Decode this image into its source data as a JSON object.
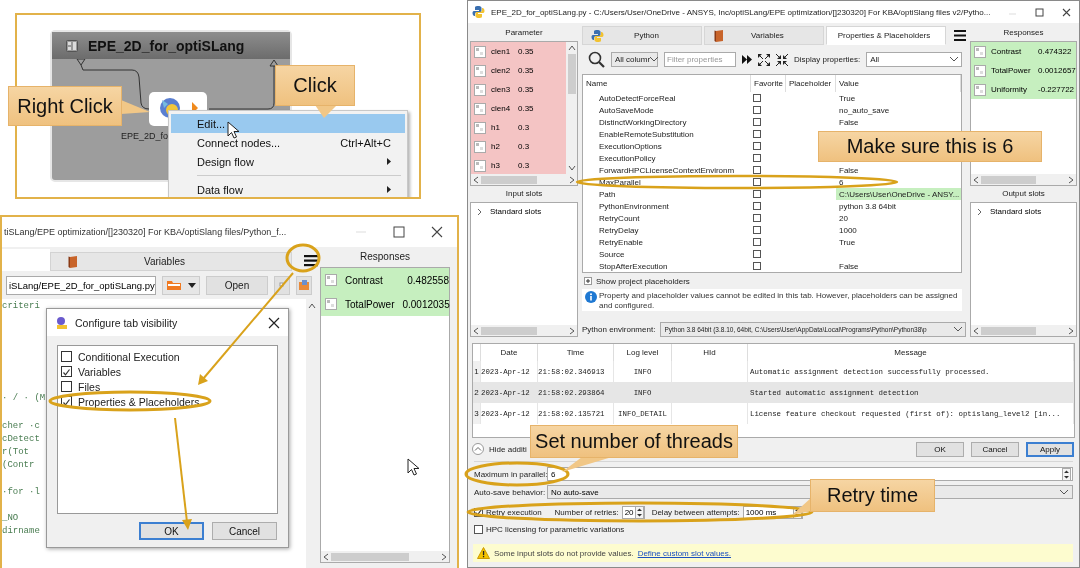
{
  "node_editor": {
    "node_title": "EPE_2D_for_optiSLang",
    "node_label": "EPE_2D_fo",
    "context_menu": [
      {
        "label": "Edit...",
        "selected": true,
        "submenu": false,
        "divider_above": false
      },
      {
        "label": "Connect nodes...",
        "shortcut": "Ctrl+Alt+C",
        "selected": false,
        "submenu": false,
        "divider_above": false
      },
      {
        "label": "Design flow",
        "selected": false,
        "submenu": true,
        "divider_above": false
      },
      {
        "label": "Data flow",
        "selected": false,
        "submenu": true,
        "divider_above": true
      }
    ],
    "callouts": [
      {
        "text": "Right Click"
      },
      {
        "text": "Click"
      }
    ]
  },
  "editor_window": {
    "title": "tiSLang/EPE optimization/[]230320] For KBA/optiSlang files/Python_f...",
    "tabs": [
      {
        "label": "Variables",
        "selected": false
      }
    ],
    "file_path": "iSLang/EPE_2D_for_optiSLang.py",
    "open_button": "Open",
    "code_blocks": [
      [
        "criteri"
      ],
      [
        "· / · (M"
      ],
      [
        "cher ·c",
        "cDetect",
        "r(Tot",
        "(Contr"
      ],
      [
        "·for ·l"
      ],
      [
        "_NO",
        "dirname"
      ]
    ],
    "dialog": {
      "title": "Configure tab visibility",
      "options": [
        {
          "label": "Conditional Execution",
          "checked": false
        },
        {
          "label": "Variables",
          "checked": true
        },
        {
          "label": "Files",
          "checked": false
        },
        {
          "label": "Properties & Placeholders",
          "checked": true
        }
      ],
      "buttons": [
        {
          "label": "OK",
          "selected": true
        },
        {
          "label": "Cancel",
          "selected": false
        }
      ]
    },
    "responses_header": "Responses",
    "responses": [
      {
        "name": "Contrast",
        "value": "0.482558"
      },
      {
        "name": "TotalPower",
        "value": "0.0012035"
      }
    ]
  },
  "properties_window": {
    "title": "EPE_2D_for_optiSLang.py - C:/Users/User/OneDrive - ANSYS, Inc/optiSLang/EPE optimization/[]230320] For KBA/optiSlang files v2/Pytho...",
    "parameter_header": "Parameter",
    "parameters": [
      {
        "name": "clen1",
        "value": "0.35"
      },
      {
        "name": "clen2",
        "value": "0.35"
      },
      {
        "name": "clen3",
        "value": "0.35"
      },
      {
        "name": "clen4",
        "value": "0.35"
      },
      {
        "name": "h1",
        "value": "0.3"
      },
      {
        "name": "h2",
        "value": "0.3"
      },
      {
        "name": "h3",
        "value": "0.3"
      }
    ],
    "input_slots_header": "Input slots",
    "input_slots": [
      "Standard slots"
    ],
    "tabs": [
      {
        "label": "Python",
        "selected": false
      },
      {
        "label": "Variables",
        "selected": false
      },
      {
        "label": "Properties & Placeholders",
        "selected": true
      }
    ],
    "column_filter": "All columr",
    "filter_placeholder": "Filter properties",
    "display_label": "Display properties:",
    "display_value": "All",
    "columns": [
      "Name",
      "Favorite",
      "Placeholder",
      "Value"
    ],
    "properties": [
      {
        "name": "AutoDetectForceReal",
        "favorite": false,
        "value": "True",
        "highlighted": false
      },
      {
        "name": "AutoSaveMode",
        "favorite": false,
        "value": "no_auto_save",
        "highlighted": false
      },
      {
        "name": "DistinctWorkingDirectory",
        "favorite": false,
        "value": "False",
        "highlighted": false
      },
      {
        "name": "EnableRemoteSubstitution",
        "favorite": false,
        "highlighted": false
      },
      {
        "name": "ExecutionOptions",
        "favorite": false
      },
      {
        "name": "ExecutionPolicy",
        "favorite": false
      },
      {
        "name": "ForwardHPCLicenseContextEnvironm",
        "favorite": false,
        "value": "False",
        "highlighted": false
      },
      {
        "name": "MaxParallel",
        "favorite": false,
        "value": "6",
        "highlighted": false
      },
      {
        "name": "Path",
        "favorite": false,
        "value": "C:\\Users\\User\\OneDrive - ANSY...",
        "highlighted": true
      },
      {
        "name": "PythonEnvironment",
        "favorite": false,
        "value": "python 3.8 64bit",
        "highlighted": false
      },
      {
        "name": "RetryCount",
        "favorite": false,
        "value": "20",
        "highlighted": false
      },
      {
        "name": "RetryDelay",
        "favorite": false,
        "value": "1000",
        "highlighted": false
      },
      {
        "name": "RetryEnable",
        "favorite": false,
        "value": "True",
        "highlighted": false
      },
      {
        "name": "Source",
        "favorite": false,
        "highlighted": false
      },
      {
        "name": "StopAfterExecution",
        "favorite": false,
        "value": "False",
        "highlighted": false
      }
    ],
    "show_placeholders": "Show project placeholders",
    "info": "Property and placeholder values cannot be edited in this tab. However, placeholders can be assigned and configured.",
    "python_env_label": "Python environment:",
    "python_env_value": "Python 3.8 64bit (3.8.10, 64bit, C:\\Users\\User\\AppData\\Local\\Programs\\Python\\Python38\\p",
    "responses_header": "Responses",
    "responses": [
      {
        "name": "Contrast",
        "value": "0.474322"
      },
      {
        "name": "TotalPower",
        "value": "0.0012657"
      },
      {
        "name": "Uniformity",
        "value": "-0.227722"
      }
    ],
    "output_slots_header": "Output slots",
    "output_slots": [
      "Standard slots"
    ],
    "log": {
      "columns": [
        "Date",
        "Time",
        "Log level",
        "HId",
        "Message"
      ],
      "rows": [
        {
          "index": "1",
          "date": "2023-Apr-12",
          "time": "21:58:02.346913",
          "level": "INFO",
          "message": "Automatic assignment detection successfully processed."
        },
        {
          "index": "2",
          "date": "2023-Apr-12",
          "time": "21:58:02.293864",
          "level": "INFO",
          "message": "Started automatic assignment detection"
        },
        {
          "index": "3",
          "date": "2023-Apr-12",
          "time": "21:58:02.135721",
          "level": "INFO_DETAIL",
          "message": "License feature checkout requested (first of): optislang_level2 [in..."
        }
      ]
    },
    "hide_button": "Hide additi",
    "buttons": [
      {
        "label": "OK",
        "selected": false
      },
      {
        "label": "Cancel",
        "selected": false
      },
      {
        "label": "Apply",
        "selected": true
      }
    ],
    "max_parallel_label": "Maximum in parallel:",
    "max_parallel": "6",
    "autosave_label": "Auto-save behavior:",
    "autosave_value": "No auto-save",
    "retry": {
      "label": "Retry execution",
      "checked": true,
      "count_label": "Number of retries:",
      "count": "20",
      "delay_label": "Delay between attempts:",
      "delay": "1000 ms"
    },
    "hpc": {
      "label": "HPC licensing for parametric variations",
      "checked": false
    },
    "warning": {
      "text": "Some input slots do not provide values.",
      "link": "Define custom slot values."
    },
    "callouts": [
      {
        "text": "Make sure this is 6"
      },
      {
        "text": "Set number of threads"
      },
      {
        "text": "Retry time"
      }
    ]
  }
}
